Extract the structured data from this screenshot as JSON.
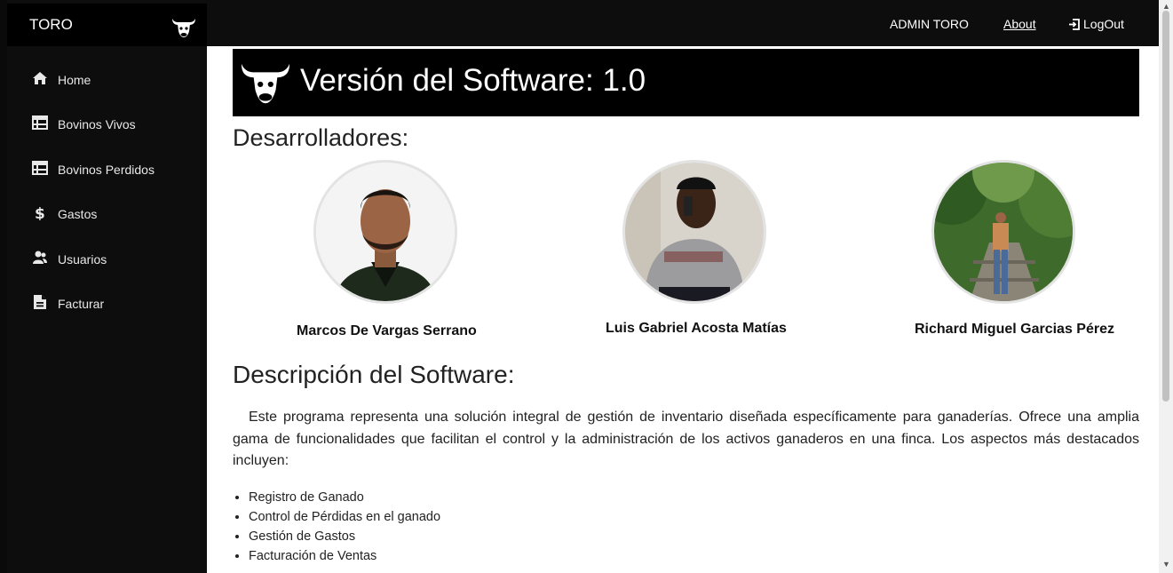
{
  "sidebar": {
    "brand": "TORO",
    "brand_icon": "bull-icon",
    "items": [
      {
        "label": "Home",
        "icon": "home-icon"
      },
      {
        "label": "Bovinos Vivos",
        "icon": "table-list-icon"
      },
      {
        "label": "Bovinos Perdidos",
        "icon": "table-list-icon"
      },
      {
        "label": "Gastos",
        "icon": "dollar-icon"
      },
      {
        "label": "Usuarios",
        "icon": "users-icon"
      },
      {
        "label": "Facturar",
        "icon": "invoice-icon"
      }
    ]
  },
  "topbar": {
    "user": "ADMIN TORO",
    "about": "About",
    "logout": "LogOut"
  },
  "banner": {
    "title": "Versión del Software: 1.0"
  },
  "developers": {
    "heading": "Desarrolladores:",
    "people": [
      {
        "name": "Marcos De Vargas Serrano"
      },
      {
        "name": "Luis Gabriel Acosta Matías"
      },
      {
        "name": "Richard Miguel Garcias Pérez"
      }
    ]
  },
  "description": {
    "heading": "Descripción del Software:",
    "text": "Este programa representa una solución integral de gestión de inventario diseñada específicamente para ganaderías. Ofrece una amplia gama de funcionalidades que facilitan el control y la administración de los activos ganaderos en una finca. Los aspectos más destacados incluyen:",
    "features": [
      "Registro de Ganado",
      "Control de Pérdidas en el ganado",
      "Gestión de Gastos",
      "Facturación de Ventas"
    ]
  },
  "colors": {
    "sidebar_bg": "#0d0d0d",
    "banner_bg": "#000000",
    "text": "#222222"
  }
}
